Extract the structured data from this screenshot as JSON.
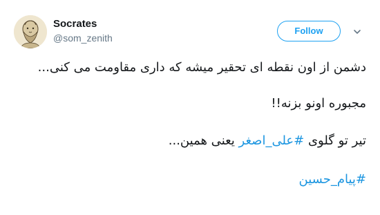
{
  "user": {
    "display_name": "Socrates",
    "handle": "@som_zenith",
    "avatar_icon": "socrates-bust-avatar"
  },
  "actions": {
    "follow_label": "Follow",
    "menu_icon": "chevron-down-icon"
  },
  "tweet": {
    "line1": "دشمن از اون نقطه ای تحقیر میشه که داری مقاومت می کنی...",
    "line2": "مجبوره اونو بزنه!!",
    "line3_prefix": "تیر تو گلوی ",
    "line3_hashtag": "#علی_اصغر",
    "line3_suffix": " یعنی همین...",
    "hashtag2": "#پیام_حسین"
  },
  "colors": {
    "accent": "#1da1f2",
    "hashtag": "#1b95e0",
    "text": "#14171a",
    "muted": "#657786"
  }
}
